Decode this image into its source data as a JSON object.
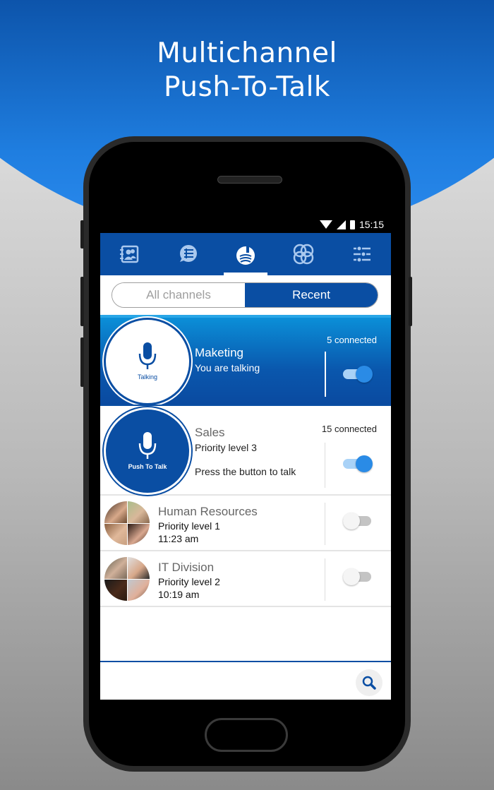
{
  "headline": {
    "line1": "Multichannel",
    "line2": "Push-To-Talk"
  },
  "status_bar": {
    "time": "15:15",
    "icons": [
      "wifi-icon",
      "signal-icon",
      "battery-icon"
    ]
  },
  "top_nav": {
    "tabs": [
      {
        "icon": "contacts-book-icon",
        "active": false
      },
      {
        "icon": "chat-list-icon",
        "active": false
      },
      {
        "icon": "walkie-talkie-icon",
        "active": true
      },
      {
        "icon": "channels-rings-icon",
        "active": false
      },
      {
        "icon": "settings-sliders-icon",
        "active": false
      }
    ]
  },
  "segmented": {
    "all_channels": "All channels",
    "recent": "Recent",
    "selected": "Recent"
  },
  "channels": [
    {
      "name": "Maketing",
      "subtitle": "You are talking",
      "ptt_label": "Talking",
      "connected": "5 connected",
      "enabled": true,
      "state": "talking"
    },
    {
      "name": "Sales",
      "subtitle": "Priority level 3",
      "hint": "Press the button to talk",
      "ptt_label": "Push To Talk",
      "connected": "15 connected",
      "enabled": true,
      "state": "idle"
    },
    {
      "name": "Human Resources",
      "subtitle": "Priority level 1",
      "time": "11:23 am",
      "enabled": false
    },
    {
      "name": "IT Division",
      "subtitle": "Priority level 2",
      "time": "10:19 am",
      "enabled": false
    }
  ],
  "bottom": {
    "search_icon": "search-icon"
  },
  "colors": {
    "brand_blue": "#0a4ea3",
    "accent_blue": "#2a8be6",
    "toggle_track_on": "#a9d2f7"
  }
}
